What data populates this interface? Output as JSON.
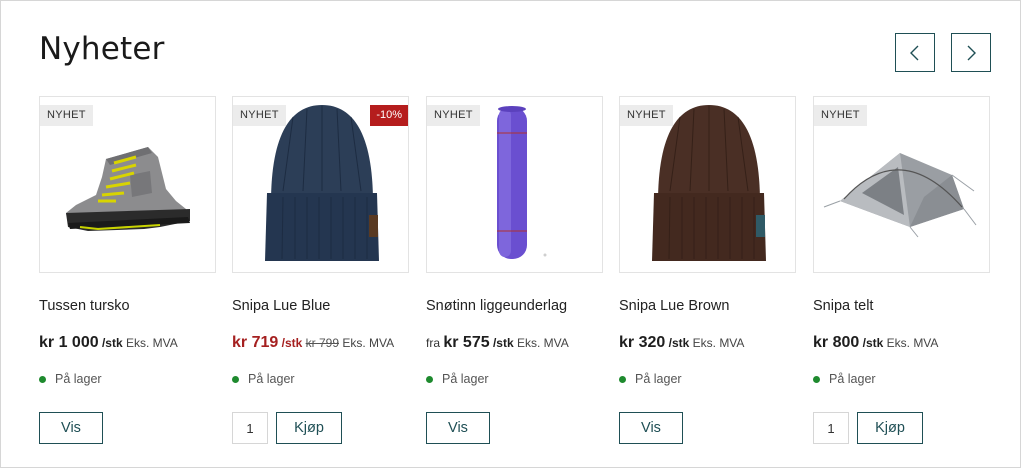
{
  "section": {
    "title": "Nyheter",
    "prev_icon": "chevron-left-icon",
    "next_icon": "chevron-right-icon"
  },
  "colors": {
    "accent": "#1f4f55",
    "sale": "#a52020",
    "discount_badge": "#b51d1d",
    "in_stock": "#1e8a2e"
  },
  "products": [
    {
      "badge": "NYHET",
      "image": "hiking-boot",
      "name": "Tussen tursko",
      "price": "kr 1 000",
      "unit": "/stk",
      "vat": "Eks. MVA",
      "stock": "På lager",
      "button": "Vis"
    },
    {
      "badge": "NYHET",
      "discount": "-10%",
      "image": "blue-beanie",
      "name": "Snipa Lue Blue",
      "price": "kr 719",
      "unit": "/stk",
      "old_price": "kr 799",
      "vat": "Eks. MVA",
      "stock": "På lager",
      "qty": "1",
      "button": "Kjøp"
    },
    {
      "badge": "NYHET",
      "image": "sleeping-pad",
      "name": "Snøtinn liggeunderlag",
      "from": "fra",
      "price": "kr 575",
      "unit": "/stk",
      "vat": "Eks. MVA",
      "stock": "På lager",
      "button": "Vis"
    },
    {
      "badge": "NYHET",
      "image": "brown-beanie",
      "name": "Snipa Lue Brown",
      "price": "kr 320",
      "unit": "/stk",
      "vat": "Eks. MVA",
      "stock": "På lager",
      "button": "Vis"
    },
    {
      "badge": "NYHET",
      "image": "dome-tent",
      "name": "Snipa telt",
      "price": "kr 800",
      "unit": "/stk",
      "vat": "Eks. MVA",
      "stock": "På lager",
      "qty": "1",
      "button": "Kjøp"
    }
  ]
}
